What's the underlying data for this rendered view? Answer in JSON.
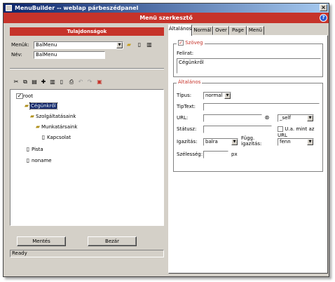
{
  "window": {
    "title": "MenuBuilder -- weblap párbeszédpanel",
    "header": "Menü szerkesztő"
  },
  "left": {
    "panel_title": "Tulajdonságok",
    "menus_label": "Menük:",
    "menus_value": "BalMenu",
    "name_label": "Név:",
    "name_value": "BalMenu",
    "tree": [
      {
        "label": "root",
        "level": 0,
        "icon": "root-checkbox-icon",
        "selected": false
      },
      {
        "label": "Cégünkről",
        "level": 1,
        "icon": "folder-icon",
        "selected": true
      },
      {
        "label": "Szolgáltatásaink",
        "level": 2,
        "icon": "folder-icon",
        "selected": false
      },
      {
        "label": "Munkatársaink",
        "level": 3,
        "icon": "folder-icon",
        "selected": false
      },
      {
        "label": "Kapcsolat",
        "level": 4,
        "icon": "document-icon",
        "selected": false
      },
      {
        "label": "Pista",
        "level": 1,
        "icon": "document-icon",
        "selected": false
      },
      {
        "label": "noname",
        "level": 1,
        "icon": "document-icon",
        "selected": false
      }
    ],
    "save_label": "Mentés",
    "close_label": "Bezár",
    "status": "Ready"
  },
  "right": {
    "tabs": [
      "Általános",
      "Normál",
      "Over",
      "Page",
      "Menü"
    ],
    "active_tab": "Általános",
    "text_group": {
      "legend": "Szöveg",
      "checked": true,
      "caption_label": "Felirat:",
      "caption_value": "Cégünkről"
    },
    "general_group": {
      "legend": "Általános",
      "type_label": "Típus:",
      "type_value": "normal",
      "tiptext_label": "TipText:",
      "url_label": "URL:",
      "target_value": "_self",
      "status_label": "Státusz:",
      "same_as_url_label": "U.a. mint az URL",
      "halign_label": "Igazítás:",
      "halign_value": "balra",
      "valign_label": "Függ. igazítás:",
      "valign_value": "fenn",
      "width_label": "Szélesség:",
      "width_unit": "px"
    }
  }
}
